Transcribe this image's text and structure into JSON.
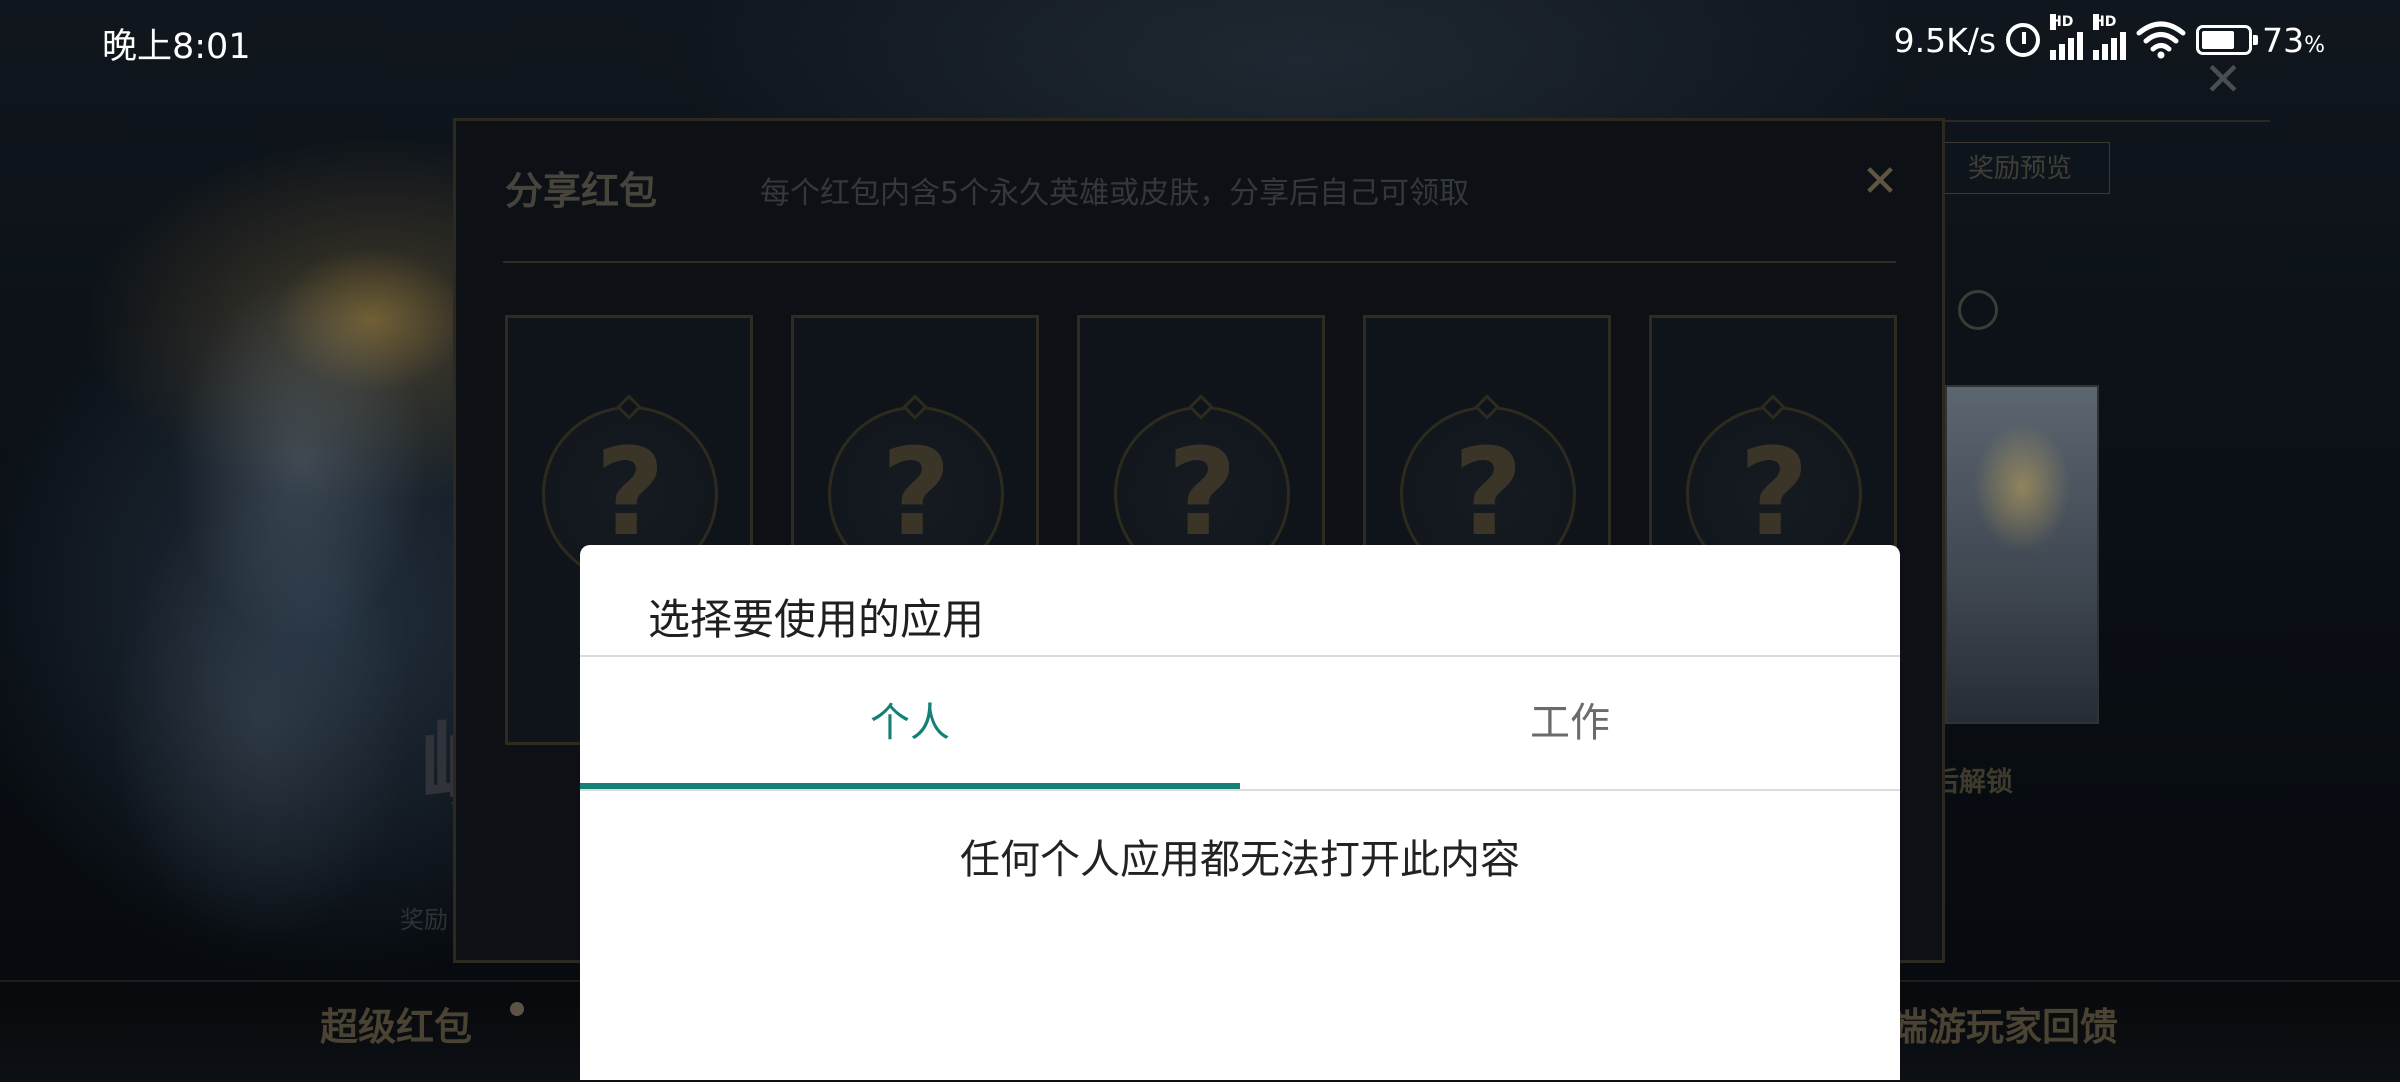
{
  "status_bar": {
    "time": "晚上8:01",
    "net_speed": "9.5K/s",
    "battery_percent": "73",
    "battery_unit": "%",
    "battery_level": 0.73,
    "signal_badge": "HD",
    "icons": [
      "alarm-icon",
      "signal-icon",
      "signal-icon",
      "wifi-icon",
      "battery-icon"
    ]
  },
  "background": {
    "reward_preview": "奖励预览",
    "unlock_text": "天后解锁",
    "left_glyph": "峡",
    "left_small": "奖励",
    "bottom_tabs": {
      "super_red_packet": "超级红包",
      "player_feedback": "端游玩家回馈"
    }
  },
  "share_panel": {
    "title": "分享红包",
    "subtitle": "每个红包内含5个永久英雄或皮肤，分享后自己可领取",
    "close_icon": "✕",
    "cards": [
      {
        "symbol": "?"
      },
      {
        "symbol": "?"
      },
      {
        "symbol": "?"
      },
      {
        "symbol": "?"
      },
      {
        "symbol": "?"
      }
    ]
  },
  "chooser": {
    "title": "选择要使用的应用",
    "tabs": [
      {
        "label": "个人",
        "selected": true
      },
      {
        "label": "工作",
        "selected": false
      }
    ],
    "empty_message": "任何个人应用都无法打开此内容",
    "accent_color": "#158075"
  }
}
